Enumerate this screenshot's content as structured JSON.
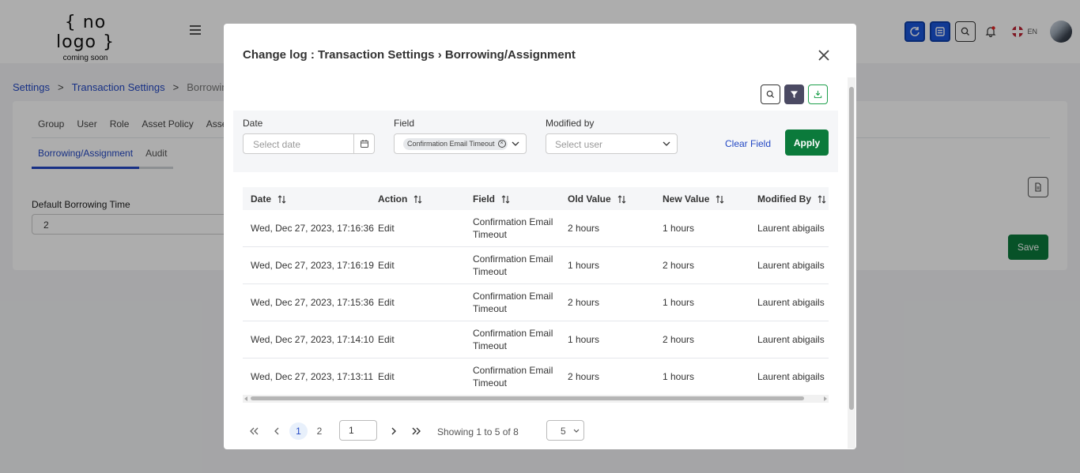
{
  "app": {
    "logo_main": "{ no logo }",
    "logo_sub": "coming soon",
    "language": "EN"
  },
  "breadcrumb": {
    "items": [
      "Settings",
      "Transaction Settings",
      "Borrowing/A"
    ],
    "separator": ">"
  },
  "settings_tabs": [
    "Group",
    "User",
    "Role",
    "Asset Policy",
    "Asse"
  ],
  "settings_subtabs": [
    "Borrowing/Assignment",
    "Audit"
  ],
  "form": {
    "label": "Default Borrowing Time",
    "value": "2",
    "save_label": "Save"
  },
  "modal": {
    "title": "Change log : Transaction Settings › Borrowing/Assignment",
    "filters": {
      "date_label": "Date",
      "date_placeholder": "Select date",
      "field_label": "Field",
      "field_chip": "Confirmation Email Timeout",
      "modified_label": "Modified by",
      "modified_placeholder": "Select user",
      "clear_label": "Clear Field",
      "apply_label": "Apply"
    },
    "table": {
      "columns": [
        "Date",
        "Action",
        "Field",
        "Old Value",
        "New Value",
        "Modified By"
      ],
      "rows": [
        {
          "date": "Wed, Dec 27, 2023, 17:16:36",
          "action": "Edit",
          "field1": "Confirmation Email",
          "field2": "Timeout",
          "old": "2 hours",
          "new": "1 hours",
          "by": "Laurent abigails"
        },
        {
          "date": "Wed, Dec 27, 2023, 17:16:19",
          "action": "Edit",
          "field1": "Confirmation Email",
          "field2": "Timeout",
          "old": "1 hours",
          "new": "2 hours",
          "by": "Laurent abigails"
        },
        {
          "date": "Wed, Dec 27, 2023, 17:15:36",
          "action": "Edit",
          "field1": "Confirmation Email",
          "field2": "Timeout",
          "old": "2 hours",
          "new": "1 hours",
          "by": "Laurent abigails"
        },
        {
          "date": "Wed, Dec 27, 2023, 17:14:10",
          "action": "Edit",
          "field1": "Confirmation Email",
          "field2": "Timeout",
          "old": "1 hours",
          "new": "2 hours",
          "by": "Laurent abigails"
        },
        {
          "date": "Wed, Dec 27, 2023, 17:13:11",
          "action": "Edit",
          "field1": "Confirmation Email",
          "field2": "Timeout",
          "old": "2 hours",
          "new": "1 hours",
          "by": "Laurent abigails"
        }
      ]
    },
    "pagination": {
      "pages": [
        "1",
        "2"
      ],
      "current_page": "1",
      "page_input": "1",
      "summary": "Showing 1 to 5 of 8",
      "per_page": "5"
    }
  },
  "colors": {
    "primary_blue": "#1a56db",
    "link_blue": "#2348c4",
    "success_green": "#0b7a3b",
    "filter_dark": "#4b4a63"
  }
}
